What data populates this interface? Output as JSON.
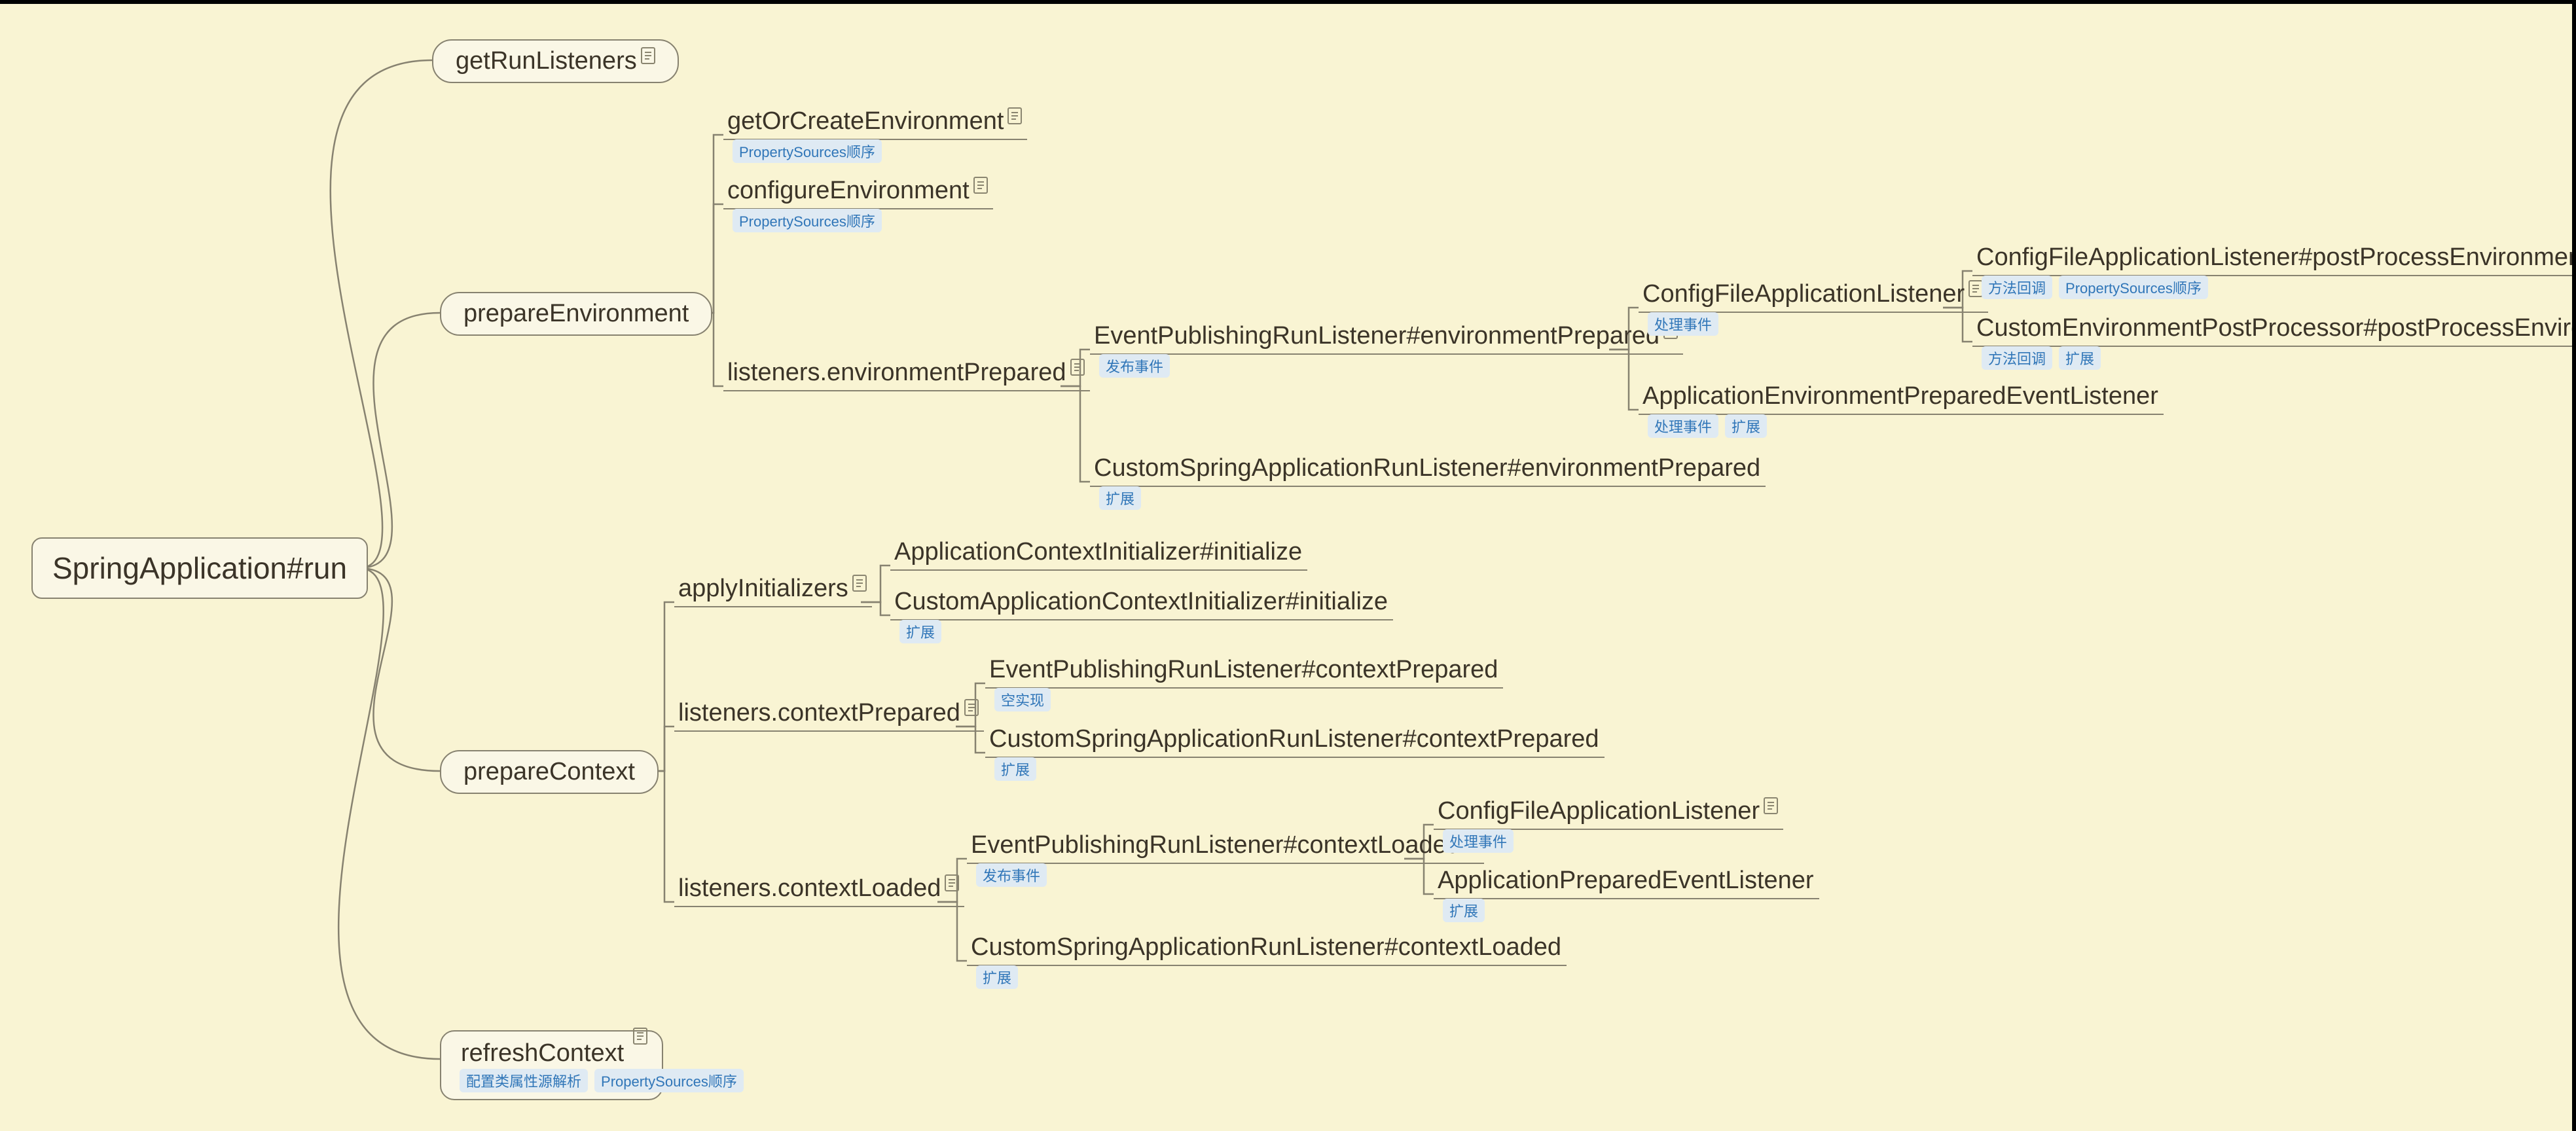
{
  "root": {
    "label": "SpringApplication#run"
  },
  "level1": {
    "getRunListeners": {
      "label": "getRunListeners"
    },
    "prepareEnvironment": {
      "label": "prepareEnvironment"
    },
    "prepareContext": {
      "label": "prepareContext"
    },
    "refreshContext": {
      "label": "refreshContext",
      "tags": [
        "配置类属性源解析",
        "PropertySources顺序"
      ]
    }
  },
  "prepEnv": {
    "getOrCreateEnvironment": {
      "label": "getOrCreateEnvironment",
      "tags": [
        "PropertySources顺序"
      ]
    },
    "configureEnvironment": {
      "label": "configureEnvironment",
      "tags": [
        "PropertySources顺序"
      ]
    },
    "listenersEnvPrepared": {
      "label": "listeners.environmentPrepared"
    }
  },
  "envPreparedChildren": {
    "eventPubEnvPrepared": {
      "label": "EventPublishingRunListener#environmentPrepared",
      "tags": [
        "发布事件"
      ]
    },
    "customRunListenerEnvPrepared": {
      "label": "CustomSpringApplicationRunListener#environmentPrepared",
      "tags": [
        "扩展"
      ]
    }
  },
  "eventPubEnvPreparedChildren": {
    "configFileAppListener": {
      "label": "ConfigFileApplicationListener",
      "tags": [
        "处理事件"
      ]
    },
    "appEnvPreparedEventListener": {
      "label": "ApplicationEnvironmentPreparedEventListener",
      "tags": [
        "处理事件",
        "扩展"
      ]
    }
  },
  "configFileChildren": {
    "configFilePostProcessEnv": {
      "label": "ConfigFileApplicationListener#postProcessEnvironment",
      "tags": [
        "方法回调",
        "PropertySources顺序"
      ]
    },
    "customEnvPostProcessor": {
      "label": "CustomEnvironmentPostProcessor#postProcessEnvironment",
      "tags": [
        "方法回调",
        "扩展"
      ]
    }
  },
  "prepCtx": {
    "applyInitializers": {
      "label": "applyInitializers"
    },
    "listenersContextPrepared": {
      "label": "listeners.contextPrepared"
    },
    "listenersContextLoaded": {
      "label": "listeners.contextLoaded"
    }
  },
  "applyInitChildren": {
    "appCtxInitialize": {
      "label": "ApplicationContextInitializer#initialize"
    },
    "customAppCtxInitialize": {
      "label": "CustomApplicationContextInitializer#initialize",
      "tags": [
        "扩展"
      ]
    }
  },
  "ctxPreparedChildren": {
    "eventPubCtxPrepared": {
      "label": "EventPublishingRunListener#contextPrepared",
      "tags": [
        "空实现"
      ]
    },
    "customRunListenerCtxPrepared": {
      "label": "CustomSpringApplicationRunListener#contextPrepared",
      "tags": [
        "扩展"
      ]
    }
  },
  "ctxLoadedChildren": {
    "eventPubCtxLoaded": {
      "label": "EventPublishingRunListener#contextLoaded",
      "tags": [
        "发布事件"
      ]
    },
    "customRunListenerCtxLoaded": {
      "label": "CustomSpringApplicationRunListener#contextLoaded",
      "tags": [
        "扩展"
      ]
    }
  },
  "eventPubCtxLoadedChildren": {
    "configFileAppListener2": {
      "label": "ConfigFileApplicationListener",
      "tags": [
        "处理事件"
      ]
    },
    "appPreparedEventListener": {
      "label": "ApplicationPreparedEventListener",
      "tags": [
        "扩展"
      ]
    }
  },
  "chart_data": {
    "type": "tree",
    "title": "SpringApplication#run",
    "root": {
      "name": "SpringApplication#run",
      "children": [
        {
          "name": "getRunListeners",
          "note": true
        },
        {
          "name": "prepareEnvironment",
          "children": [
            {
              "name": "getOrCreateEnvironment",
              "note": true,
              "tags": [
                "PropertySources顺序"
              ]
            },
            {
              "name": "configureEnvironment",
              "note": true,
              "tags": [
                "PropertySources顺序"
              ]
            },
            {
              "name": "listeners.environmentPrepared",
              "note": true,
              "children": [
                {
                  "name": "EventPublishingRunListener#environmentPrepared",
                  "note": true,
                  "tags": [
                    "发布事件"
                  ],
                  "children": [
                    {
                      "name": "ConfigFileApplicationListener",
                      "note": true,
                      "tags": [
                        "处理事件"
                      ],
                      "children": [
                        {
                          "name": "ConfigFileApplicationListener#postProcessEnvironment",
                          "note": true,
                          "tags": [
                            "方法回调",
                            "PropertySources顺序"
                          ]
                        },
                        {
                          "name": "CustomEnvironmentPostProcessor#postProcessEnvironment",
                          "tags": [
                            "方法回调",
                            "扩展"
                          ]
                        }
                      ]
                    },
                    {
                      "name": "ApplicationEnvironmentPreparedEventListener",
                      "tags": [
                        "处理事件",
                        "扩展"
                      ]
                    }
                  ]
                },
                {
                  "name": "CustomSpringApplicationRunListener#environmentPrepared",
                  "tags": [
                    "扩展"
                  ]
                }
              ]
            }
          ]
        },
        {
          "name": "prepareContext",
          "children": [
            {
              "name": "applyInitializers",
              "note": true,
              "children": [
                {
                  "name": "ApplicationContextInitializer#initialize"
                },
                {
                  "name": "CustomApplicationContextInitializer#initialize",
                  "tags": [
                    "扩展"
                  ]
                }
              ]
            },
            {
              "name": "listeners.contextPrepared",
              "note": true,
              "children": [
                {
                  "name": "EventPublishingRunListener#contextPrepared",
                  "tags": [
                    "空实现"
                  ]
                },
                {
                  "name": "CustomSpringApplicationRunListener#contextPrepared",
                  "tags": [
                    "扩展"
                  ]
                }
              ]
            },
            {
              "name": "listeners.contextLoaded",
              "note": true,
              "children": [
                {
                  "name": "EventPublishingRunListener#contextLoaded",
                  "note": true,
                  "tags": [
                    "发布事件"
                  ],
                  "children": [
                    {
                      "name": "ConfigFileApplicationListener",
                      "note": true,
                      "tags": [
                        "处理事件"
                      ]
                    },
                    {
                      "name": "ApplicationPreparedEventListener",
                      "tags": [
                        "扩展"
                      ]
                    }
                  ]
                },
                {
                  "name": "CustomSpringApplicationRunListener#contextLoaded",
                  "tags": [
                    "扩展"
                  ]
                }
              ]
            }
          ]
        },
        {
          "name": "refreshContext",
          "note": true,
          "tags": [
            "配置类属性源解析",
            "PropertySources顺序"
          ]
        }
      ]
    }
  }
}
